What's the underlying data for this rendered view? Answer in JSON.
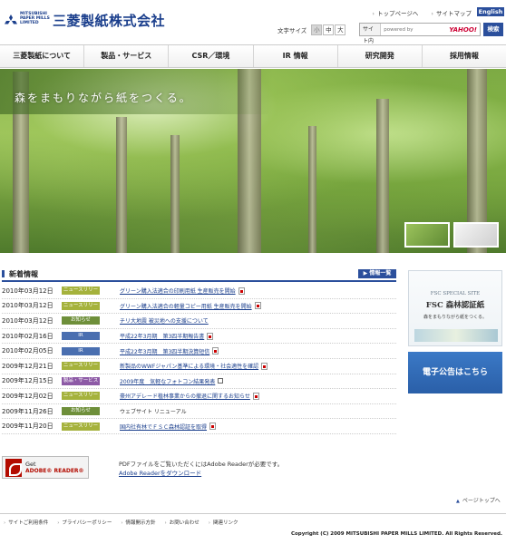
{
  "header": {
    "logo_small": "MITSUBISHI PAPER MILLS LIMITED",
    "logo_jp": "三菱製紙株式会社",
    "top_links": [
      "トップページへ",
      "サイトマップ"
    ],
    "english_label": "English",
    "fontsize_label": "文字サイズ",
    "fontsize_options": [
      "小",
      "中",
      "大"
    ],
    "search_label": "サイト内検索",
    "search_placeholder": "powered by",
    "search_provider": "YAHOO!",
    "search_button": "検索"
  },
  "nav": [
    "三菱製紙について",
    "製品・サービス",
    "CSR／環境",
    "IR 情報",
    "研究開発",
    "採用情報"
  ],
  "hero": {
    "tagline": "森をまもりながら紙をつくる。"
  },
  "news": {
    "title": "新着情報",
    "all_link": "▶ 情報一覧",
    "items": [
      {
        "date": "2010年03月12日",
        "badge": "ニュースリリース",
        "color": "#a5b23c",
        "text": "グリーン購入法適合の印刷用紙 生産販売を開始",
        "icon": "pdf",
        "link": true
      },
      {
        "date": "2010年03月12日",
        "badge": "ニュースリリース",
        "color": "#a5b23c",
        "text": "グリーン購入法適合の軽量コピー用紙 生産販売を開始",
        "icon": "pdf",
        "link": true
      },
      {
        "date": "2010年03月12日",
        "badge": "お知らせ",
        "color": "#6e8f3a",
        "text": "チリ大地震 被災地への支援について",
        "icon": "",
        "link": true
      },
      {
        "date": "2010年02月16日",
        "badge": "IR",
        "color": "#4a6fb0",
        "text": "平成22年3月期　第3四半期報告書",
        "icon": "pdf",
        "link": true
      },
      {
        "date": "2010年02月05日",
        "badge": "IR",
        "color": "#4a6fb0",
        "text": "平成22年3月期　第3四半期決算短信",
        "icon": "pdf",
        "link": true
      },
      {
        "date": "2009年12月21日",
        "badge": "ニュースリリース",
        "color": "#a5b23c",
        "text": "新製品のWWFジャパン基準による環境・社会適性を確認",
        "icon": "pdf",
        "link": true
      },
      {
        "date": "2009年12月15日",
        "badge": "製品・サービス",
        "color": "#8d5aa6",
        "text": "2009年度　気軽なフォトコン結果発表",
        "icon": "ext",
        "link": true
      },
      {
        "date": "2009年12月02日",
        "badge": "ニュースリリース",
        "color": "#a5b23c",
        "text": "豪州アデレード植林事業からの撤退に関するお知らせ",
        "icon": "pdf",
        "link": true
      },
      {
        "date": "2009年11月26日",
        "badge": "お知らせ",
        "color": "#6e8f3a",
        "text": "ウェブサイト リニューアル",
        "icon": "",
        "link": false
      },
      {
        "date": "2009年11月20日",
        "badge": "ニュースリリース",
        "color": "#a5b23c",
        "text": "国内社有林でＦＳＣ森林認証を取得",
        "icon": "pdf",
        "link": true
      }
    ]
  },
  "side": {
    "fsc_special": "FSC SPECIAL SITE",
    "fsc_main": "FSC 森林認証紙",
    "fsc_sub": "森をまもりながら紙をつくる。",
    "denshi": "電子公告はこちら"
  },
  "adobe": {
    "get": "Get",
    "reader": "ADOBE® READER®",
    "note": "PDFファイルをご覧いただくにはAdobe Readerが必要です。",
    "link": "Adobe Readerをダウンロード"
  },
  "pagetop": "ページトップへ",
  "footer": {
    "links": [
      "サイトご利用条件",
      "プライバシーポリシー",
      "情報開示方針",
      "お問い合わせ",
      "関連リンク"
    ],
    "copyright": "Copyright (C) 2009 MITSUBISHI PAPER MILLS LIMITED. All Rights Reserved."
  }
}
